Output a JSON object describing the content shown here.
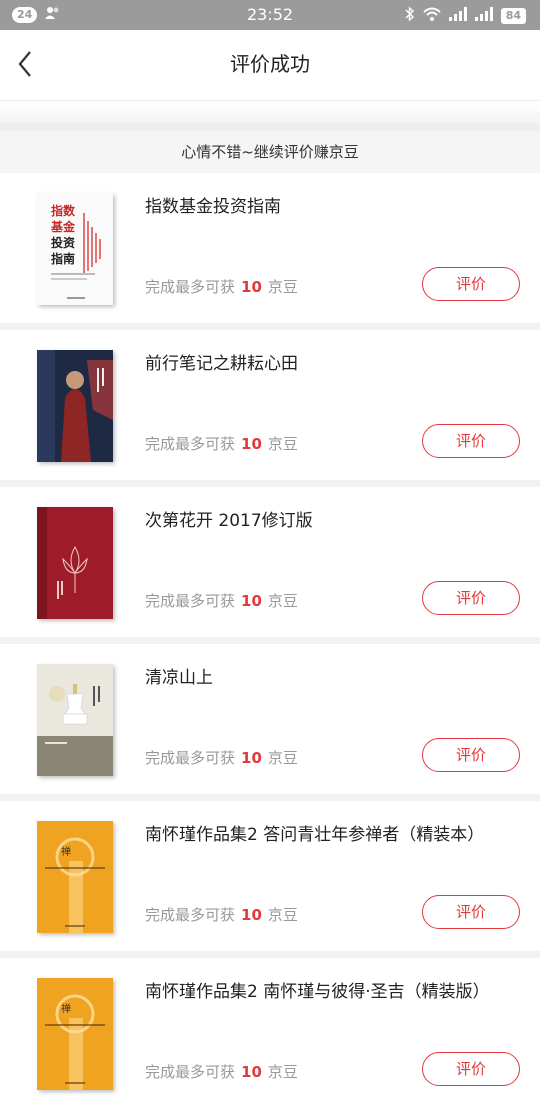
{
  "status_bar": {
    "notif_count": "24",
    "time": "23:52",
    "battery": "84"
  },
  "header": {
    "title": "评价成功"
  },
  "banner": {
    "text": "心情不错~继续评价赚京豆"
  },
  "reward": {
    "prefix": "完成最多可获",
    "amount": "10",
    "unit": "京豆"
  },
  "rate_button_label": "评价",
  "items": [
    {
      "title": "指数基金投资指南",
      "cover_icon": "book-cover-index-fund"
    },
    {
      "title": "前行笔记之耕耘心田",
      "cover_icon": "book-cover-monk"
    },
    {
      "title": "次第花开 2017修订版",
      "cover_icon": "book-cover-red-lotus"
    },
    {
      "title": "清凉山上",
      "cover_icon": "book-cover-stupa"
    },
    {
      "title": "南怀瑾作品集2 答问青壮年参禅者（精装本）",
      "cover_icon": "book-cover-orange"
    },
    {
      "title": "南怀瑾作品集2 南怀瑾与彼得·圣吉（精装版）",
      "cover_icon": "book-cover-orange"
    }
  ],
  "colors": {
    "accent": "#e4393c",
    "status_bar": "#9b9b9b"
  }
}
